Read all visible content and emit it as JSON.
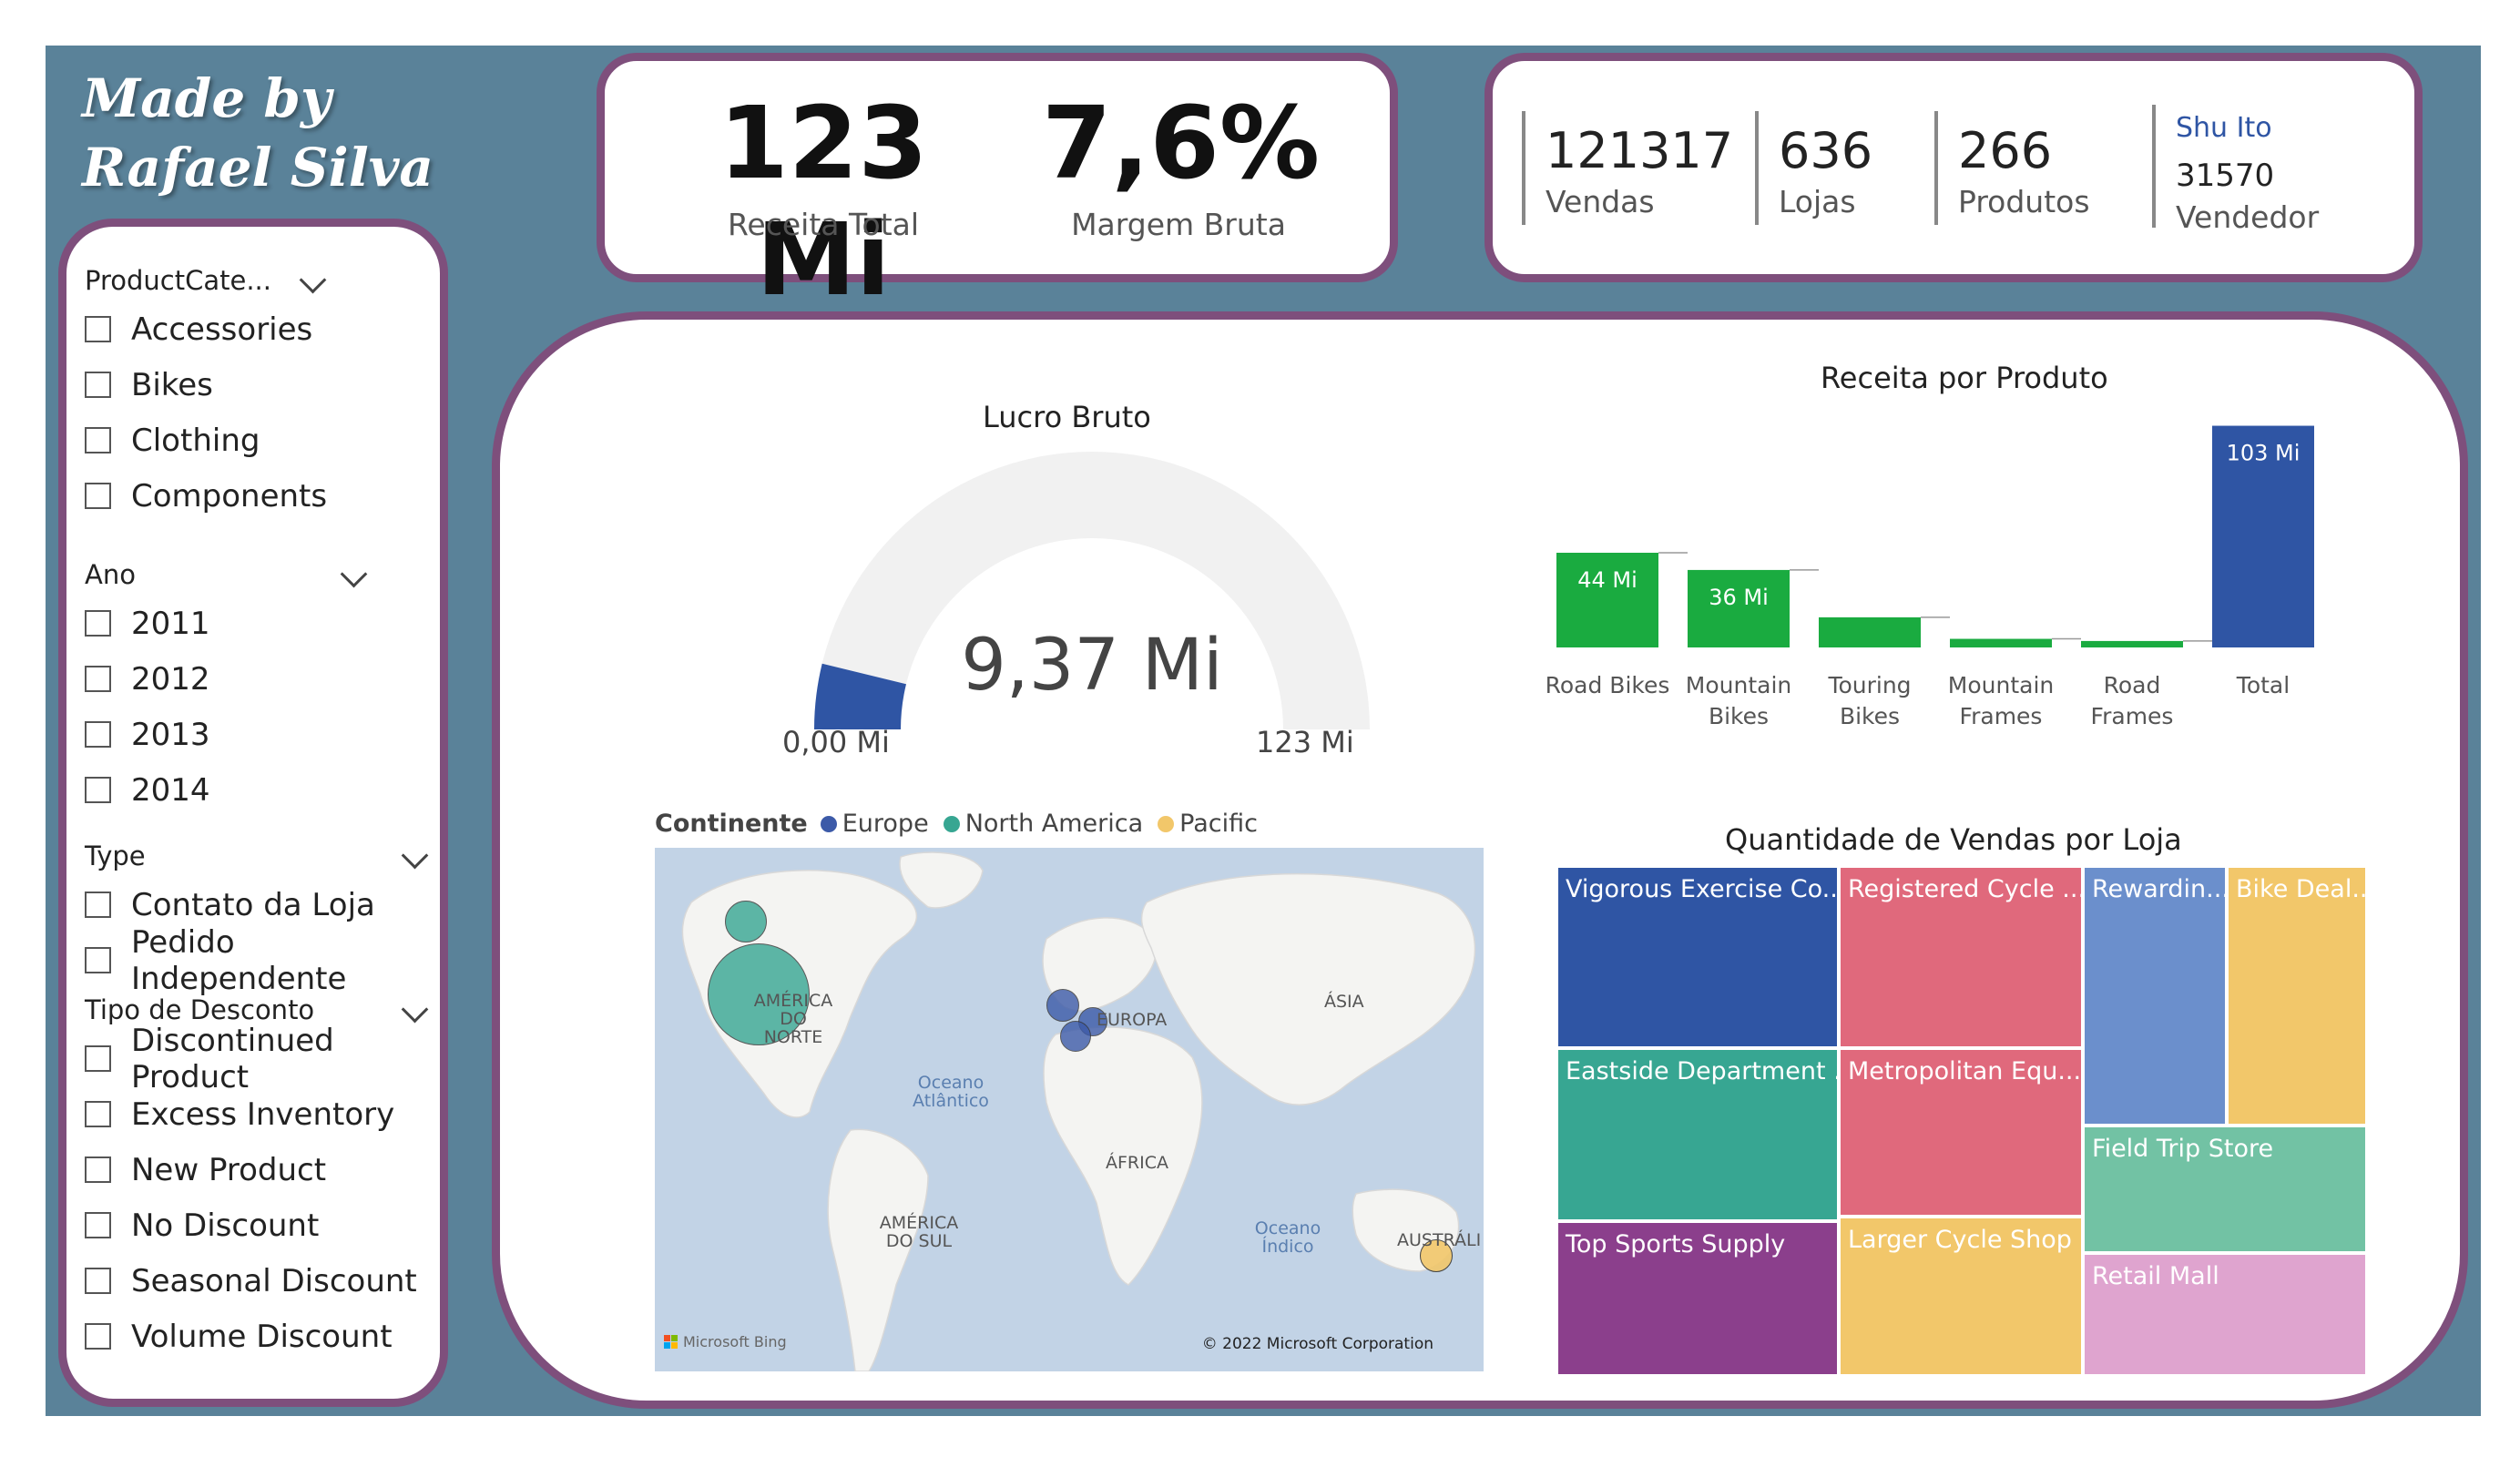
{
  "brand": {
    "line1": "Made by",
    "line2": "Rafael Silva"
  },
  "slicers": {
    "product_category": {
      "title": "ProductCate...",
      "items": [
        "Accessories",
        "Bikes",
        "Clothing",
        "Components"
      ]
    },
    "year": {
      "title": "Ano",
      "items": [
        "2011",
        "2012",
        "2013",
        "2014"
      ]
    },
    "type": {
      "title": "Type",
      "items": [
        "Contato da Loja",
        "Pedido Independente"
      ]
    },
    "discount": {
      "title": "Tipo de Desconto",
      "items": [
        "Discontinued Product",
        "Excess Inventory",
        "New Product",
        "No Discount",
        "Seasonal Discount",
        "Volume Discount"
      ]
    }
  },
  "kpis": {
    "revenue": {
      "value": "123 Mi",
      "label": "Receita Total"
    },
    "margin": {
      "value": "7,6%",
      "label": "Margem Bruta"
    },
    "sales": {
      "value": "121317",
      "label": "Vendas"
    },
    "stores": {
      "value": "636",
      "label": "Lojas"
    },
    "products": {
      "value": "266",
      "label": "Produtos"
    },
    "seller": {
      "name": "Shu Ito",
      "value": "31570",
      "label": "Vendedor"
    }
  },
  "gauge": {
    "title": "Lucro Bruto",
    "value_label": "9,37 Mi",
    "min_label": "0,00 Mi",
    "max_label": "123 Mi",
    "value": 9.37,
    "max": 123,
    "fill_color": "#2f55a4",
    "track_color": "#f1f1f1"
  },
  "map": {
    "legend_title": "Continente",
    "legend": [
      {
        "name": "Europe",
        "color": "#3c5aa8"
      },
      {
        "name": "North America",
        "color": "#37a692"
      },
      {
        "name": "Pacific",
        "color": "#f2c76a"
      }
    ],
    "labels": {
      "north_america": "AMÉRICA DO NORTE",
      "south_america": "AMÉRICA DO SUL",
      "europe": "EUROPA",
      "asia": "ÁSIA",
      "africa": "ÁFRICA",
      "australia": "AUSTRÁLI",
      "atlantic": "Oceano Atlântico",
      "indian": "Oceano Índico"
    },
    "attribution_left": "Microsoft Bing",
    "attribution_right": "© 2022 Microsoft Corporation"
  },
  "chart_data": [
    {
      "type": "bar",
      "title": "Receita por Produto",
      "subtype": "waterfall",
      "categories": [
        "Road Bikes",
        "Mountain Bikes",
        "Touring Bikes",
        "Mountain Frames",
        "Road Frames",
        "Total"
      ],
      "values": [
        44,
        36,
        14,
        4,
        3,
        103
      ],
      "data_labels": [
        "44 Mi",
        "36 Mi",
        "",
        "",
        "",
        "103 Mi"
      ],
      "increase_color": "#1aab40",
      "total_color": "#2f55a4",
      "ylim": [
        0,
        110
      ]
    },
    {
      "type": "treemap",
      "title": "Quantidade de Vendas por Loja",
      "series": [
        {
          "name": "Vigorous Exercise Co...",
          "color": "#2f55a4"
        },
        {
          "name": "Eastside Department ...",
          "color": "#37a692"
        },
        {
          "name": "Top Sports Supply",
          "color": "#8b3f8c"
        },
        {
          "name": "Registered Cycle ...",
          "color": "#e0697c"
        },
        {
          "name": "Metropolitan Equ...",
          "color": "#e0697c"
        },
        {
          "name": "Larger Cycle Shop",
          "color": "#f2c76a"
        },
        {
          "name": "Rewardin...",
          "color": "#6b8fcc"
        },
        {
          "name": "Bike Deal...",
          "color": "#f2c76a"
        },
        {
          "name": "Field Trip Store",
          "color": "#72c2a4"
        },
        {
          "name": "Retail Mall",
          "color": "#dfa4cf"
        }
      ]
    }
  ]
}
